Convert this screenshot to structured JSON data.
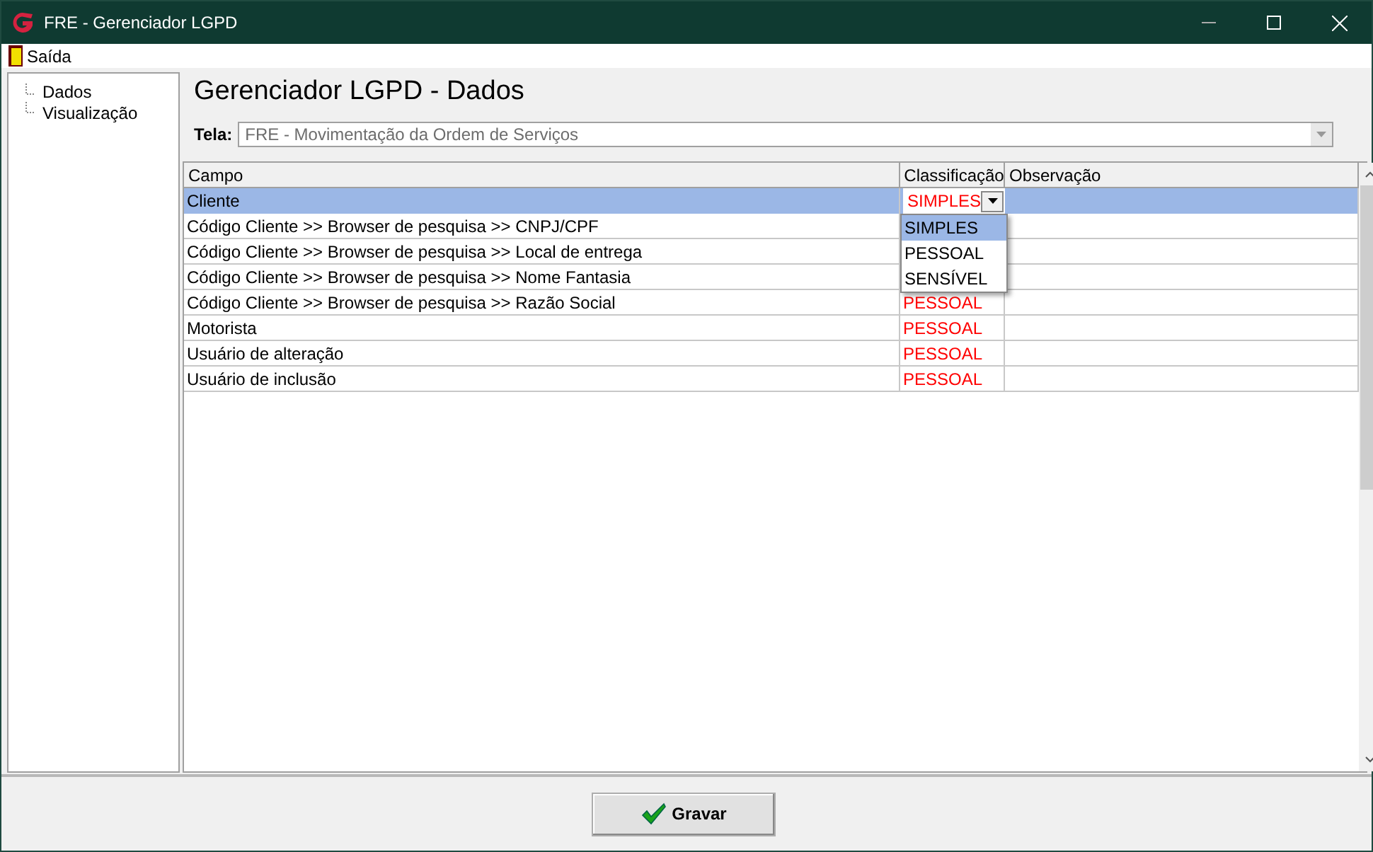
{
  "window": {
    "title": "FRE - Gerenciador LGPD"
  },
  "menu": [
    {
      "label": "Saída"
    }
  ],
  "sidebar": {
    "items": [
      {
        "label": "Dados",
        "selected": false
      },
      {
        "label": "Visualização",
        "selected": false
      }
    ]
  },
  "heading": "Gerenciador LGPD - Dados",
  "screen_field": {
    "label": "Tela:",
    "value": "FRE - Movimentação da Ordem de Serviços",
    "disabled": true
  },
  "table": {
    "columns": [
      "Campo",
      "Classificação",
      "Observação"
    ],
    "rows": [
      {
        "campo": "Cliente",
        "classificacao": "SIMPLES",
        "selected": true,
        "editing": true
      },
      {
        "campo": "Código Cliente >> Browser de pesquisa >> CNPJ/CPF",
        "selected": false,
        "editing": false
      },
      {
        "campo": "Código Cliente >> Browser de pesquisa >> Local de entrega",
        "selected": false,
        "editing": false
      },
      {
        "campo": "Código Cliente >> Browser de pesquisa >> Nome Fantasia",
        "selected": false,
        "editing": false
      },
      {
        "campo": "Código Cliente >> Browser de pesquisa >> Razão Social",
        "classificacao": "PESSOAL",
        "selected": false,
        "editing": false
      },
      {
        "campo": "Motorista",
        "classificacao": "PESSOAL",
        "selected": false,
        "editing": false
      },
      {
        "campo": "Usuário de alteração",
        "classificacao": "PESSOAL",
        "selected": false,
        "editing": false
      },
      {
        "campo": "Usuário de inclusão",
        "classificacao": "PESSOAL",
        "selected": false,
        "editing": false
      }
    ]
  },
  "dropdown": {
    "options": [
      {
        "label": "SIMPLES",
        "selected": true
      },
      {
        "label": "PESSOAL",
        "selected": false
      },
      {
        "label": "SENSÍVEL",
        "selected": false
      }
    ]
  },
  "buttons": [
    {
      "label": "Gravar"
    }
  ]
}
